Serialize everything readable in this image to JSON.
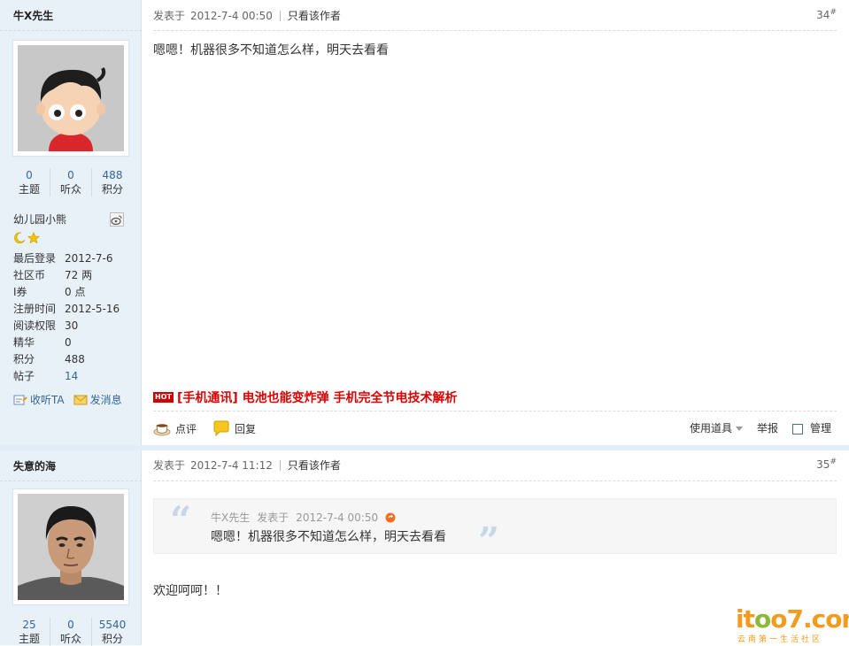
{
  "posts": [
    {
      "author": "牛X先生",
      "stats": [
        {
          "num": "0",
          "label": "主题"
        },
        {
          "num": "0",
          "label": "听众"
        },
        {
          "num": "488",
          "label": "积分"
        }
      ],
      "group": "幼儿园小熊",
      "info": [
        {
          "k": "最后登录",
          "v": "2012-7-6"
        },
        {
          "k": "社区币",
          "v": "72 两"
        },
        {
          "k": "I券",
          "v": "0 点"
        },
        {
          "k": "注册时间",
          "v": "2012-5-16"
        },
        {
          "k": "阅读权限",
          "v": "30"
        },
        {
          "k": "精华",
          "v": "0"
        },
        {
          "k": "积分",
          "v": "488"
        },
        {
          "k": "帖子",
          "v": "14"
        }
      ],
      "follow_label": "收听TA",
      "message_label": "发消息",
      "posted_label": "发表于",
      "time": "2012-7-4 00:50",
      "author_only": "只看该作者",
      "floor": "34",
      "floor_suffix": "#",
      "content": "嗯嗯！机器很多不知道怎么样，明天去看看",
      "hot_badge": "HOT",
      "hot_link": "[手机通讯] 电池也能变炸弹  手机完全节电技术解析",
      "comment_label": "点评",
      "reply_label": "回复",
      "tools_label": "使用道具",
      "report_label": "举报",
      "manage_label": "管理"
    },
    {
      "author": "失意的海",
      "stats": [
        {
          "num": "25",
          "label": "主题"
        },
        {
          "num": "0",
          "label": "听众"
        },
        {
          "num": "5540",
          "label": "积分"
        }
      ],
      "posted_label": "发表于",
      "time": "2012-7-4 11:12",
      "author_only": "只看该作者",
      "floor": "35",
      "floor_suffix": "#",
      "quote": {
        "author": "牛X先生",
        "posted_label": "发表于",
        "time": "2012-7-4 00:50",
        "text": "嗯嗯！机器很多不知道怎么样，明天去看看"
      },
      "content": "欢迎呵呵！！"
    }
  ],
  "logo": {
    "main_a": "it",
    "main_b": "o",
    "main_c": "o7.com",
    "tagline": "云南第一生活社区"
  },
  "colors": {
    "sidebar_bg": "#e9f1f8",
    "link": "#336699",
    "hot": "#dd0000",
    "logo_orange": "#f29c1f",
    "logo_green": "#8fb83a"
  }
}
